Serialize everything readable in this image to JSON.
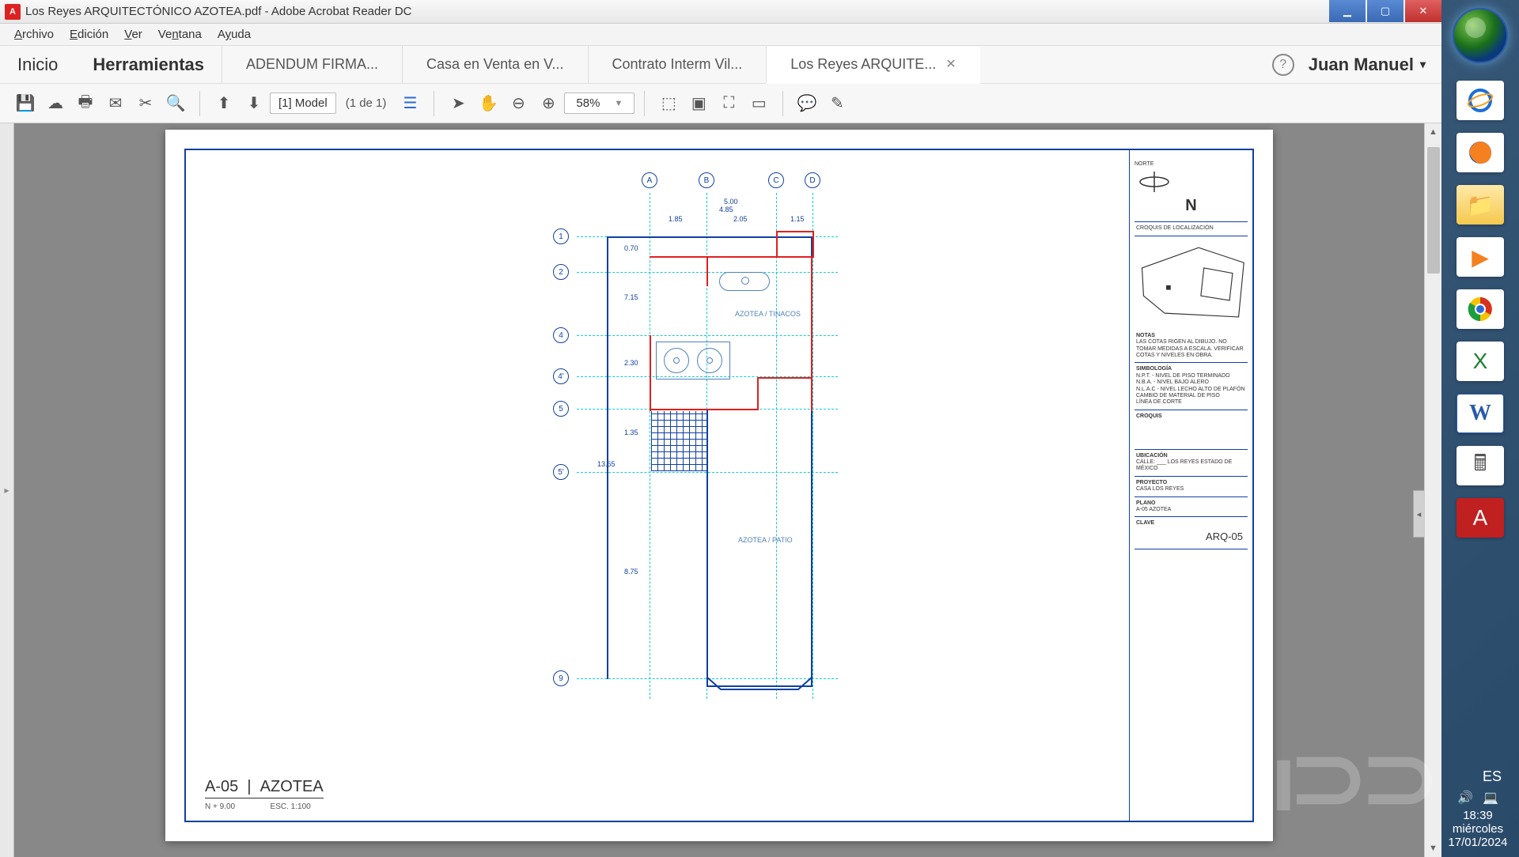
{
  "window": {
    "title": "Los Reyes ARQUITECTÓNICO AZOTEA.pdf - Adobe Acrobat Reader DC"
  },
  "menu": {
    "archivo": "Archivo",
    "edicion": "Edición",
    "ver": "Ver",
    "ventana": "Ventana",
    "ayuda": "Ayuda"
  },
  "tabs": {
    "inicio": "Inicio",
    "herramientas": "Herramientas",
    "docs": [
      {
        "label": "ADENDUM FIRMA...",
        "active": false
      },
      {
        "label": "Casa en Venta en V...",
        "active": false
      },
      {
        "label": "Contrato Interm Vil...",
        "active": false
      },
      {
        "label": "Los Reyes ARQUITE...",
        "active": true
      }
    ],
    "user": "Juan Manuel"
  },
  "toolbar": {
    "page_indicator": "[1] Model",
    "page_count": "(1 de 1)",
    "zoom": "58%"
  },
  "drawing": {
    "grid_cols": [
      "A",
      "B",
      "C",
      "D"
    ],
    "grid_rows": [
      "1",
      "2",
      "4",
      "4'",
      "5",
      "5'",
      "9"
    ],
    "dims": {
      "d1": "5.00",
      "d2": "4.85",
      "d3": "1.85",
      "d4": "2.05",
      "d5": "1.15",
      "v1": "0.70",
      "v2": "7.15",
      "v3": "2.30",
      "v4": "1.35",
      "v5": "8.75",
      "total": "13.65"
    },
    "labels": {
      "azotea_tinacos": "AZOTEA / TINACOS",
      "azotea_patio": "AZOTEA / PATIO"
    },
    "title": {
      "code": "A-05",
      "name": "AZOTEA",
      "level": "N + 9.00",
      "scale": "ESC. 1:100"
    }
  },
  "titleblock": {
    "north": "N",
    "croquis": "CROQUIS DE LOCALIZACIÓN",
    "notas_h": "NOTAS",
    "notas": "LAS COTAS RIGEN AL DIBUJO. NO TOMAR MEDIDAS A ESCALA. VERIFICAR COTAS Y NIVELES EN OBRA.",
    "simbologia_h": "SIMBOLOGÍA",
    "npt": "N.P.T. - NIVEL DE PISO TERMINADO",
    "nba": "N.B.A. - NIVEL BAJO ALERO",
    "nlac": "N.L.A.C - NIVEL LECHO ALTO DE PLAFÓN",
    "camb": "CAMBIO DE MATERIAL DE PISO",
    "linea": "LÍNEA DE CORTE",
    "croquis2": "CROQUIS",
    "ubic_h": "UBICACIÓN",
    "ubic": "CALLE: ___ LOS REYES ESTADO DE MÉXICO",
    "proy_h": "PROYECTO",
    "proy": "CASA LOS REYES",
    "plano_h": "PLANO",
    "plano": "A-05 AZOTEA",
    "clave_h": "CLAVE",
    "arq": "ARQ-05"
  },
  "tray": {
    "lang": "ES",
    "time": "18:39",
    "day": "miércoles",
    "date": "17/01/2024"
  }
}
